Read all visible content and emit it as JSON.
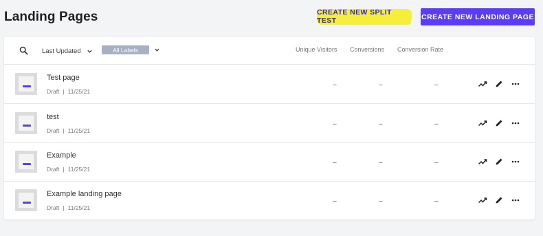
{
  "header": {
    "title": "Landing Pages",
    "split_test_label": "CREATE NEW SPLIT TEST",
    "new_page_label": "CREATE NEW LANDING PAGE"
  },
  "toolbar": {
    "sort_value": "Last Updated",
    "labels_value": "All Labels"
  },
  "columns": {
    "unique_visitors": "Unique Visitors",
    "conversions": "Conversions",
    "conversion_rate": "Conversion Rate"
  },
  "rows": [
    {
      "title": "Test page",
      "status": "Draft",
      "sep": "|",
      "date": "11/25/21",
      "visitors": "–",
      "conversions": "–",
      "rate": "–"
    },
    {
      "title": "test",
      "status": "Draft",
      "sep": "|",
      "date": "11/25/21",
      "visitors": "–",
      "conversions": "–",
      "rate": "–"
    },
    {
      "title": "Example",
      "status": "Draft",
      "sep": "|",
      "date": "11/25/21",
      "visitors": "–",
      "conversions": "–",
      "rate": "–"
    },
    {
      "title": "Example landing page",
      "status": "Draft",
      "sep": "|",
      "date": "11/25/21",
      "visitors": "–",
      "conversions": "–",
      "rate": "–"
    }
  ],
  "icons": {
    "search": "search-icon",
    "chevron": "chevron-down-icon",
    "trend": "trending-up-icon",
    "edit": "pencil-icon",
    "more": "more-horizontal-icon"
  },
  "colors": {
    "accent": "#5b3df5",
    "highlight": "#f5ee3a",
    "label_pill": "#a7b1c2"
  }
}
